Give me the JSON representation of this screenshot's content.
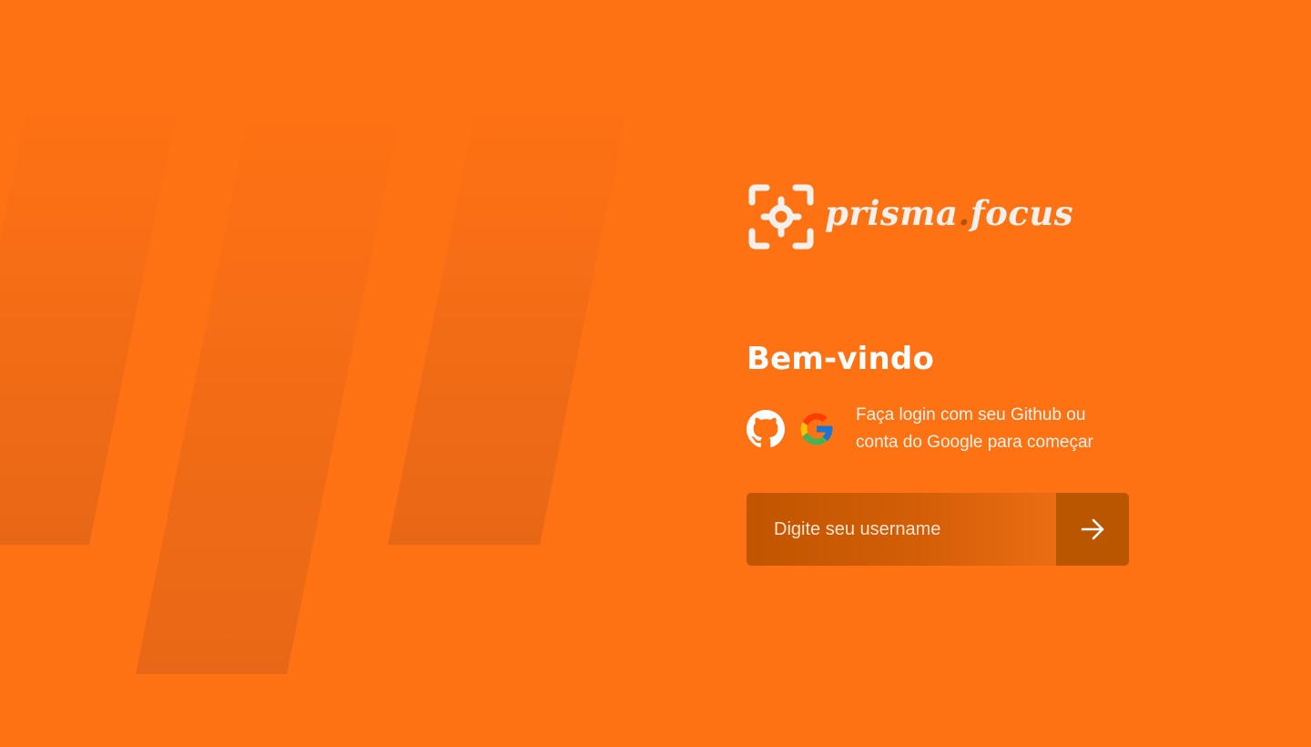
{
  "brand": {
    "name_part1": "prisma",
    "separator": ".",
    "name_part2": "focus",
    "logo_icon": "focus-target-icon"
  },
  "welcome": {
    "title": "Bem-vindo",
    "description": "Faça login com seu Github ou conta do Google para começar"
  },
  "providers": [
    {
      "name": "Github",
      "icon": "github-icon"
    },
    {
      "name": "Google",
      "icon": "google-icon"
    }
  ],
  "login": {
    "placeholder": "Digite seu username",
    "submit_icon": "arrow-right-icon"
  },
  "colors": {
    "background": "#FF7214",
    "input_bg": "#C15500",
    "button_bg": "#BA5600",
    "logo_text": "#F5F0EB",
    "logo_dot": "#B95200"
  }
}
